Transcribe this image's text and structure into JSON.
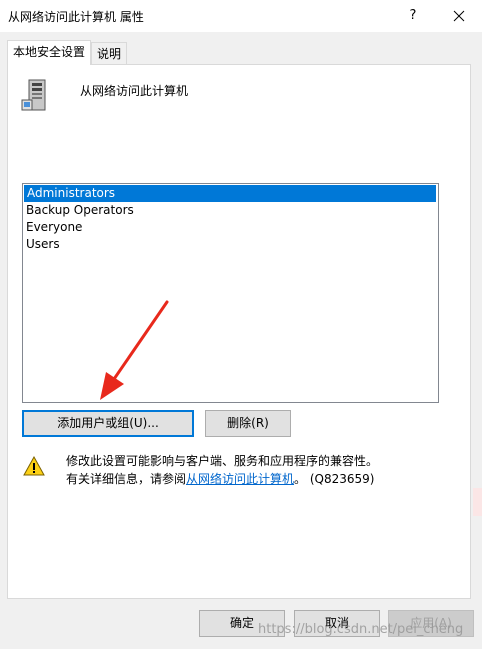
{
  "window": {
    "title": "从网络访问此计算机 属性",
    "help_label": "?",
    "close_icon": "close-icon"
  },
  "tabs": [
    {
      "label": "本地安全设置",
      "active": true
    },
    {
      "label": "说明",
      "active": false
    }
  ],
  "policy": {
    "icon": "server-icon",
    "name": "从网络访问此计算机"
  },
  "principals": [
    {
      "name": "Administrators",
      "selected": true
    },
    {
      "name": "Backup Operators",
      "selected": false
    },
    {
      "name": "Everyone",
      "selected": false
    },
    {
      "name": "Users",
      "selected": false
    }
  ],
  "buttons": {
    "add": "添加用户或组(U)...",
    "remove": "删除(R)",
    "ok": "确定",
    "cancel": "取消",
    "apply": "应用(A)"
  },
  "warning": {
    "icon": "warning-icon",
    "line1": "修改此设置可能影响与客户端、服务和应用程序的兼容性。",
    "line2_prefix": "有关详细信息，请参阅",
    "link_text": "从网络访问此计算机",
    "line2_suffix": "。 (Q823659)"
  },
  "watermark": "https://blog.csdn.net/pei_cheng",
  "colors": {
    "selection": "#0078d7",
    "arrow": "#e8291c",
    "link": "#0066cc"
  }
}
